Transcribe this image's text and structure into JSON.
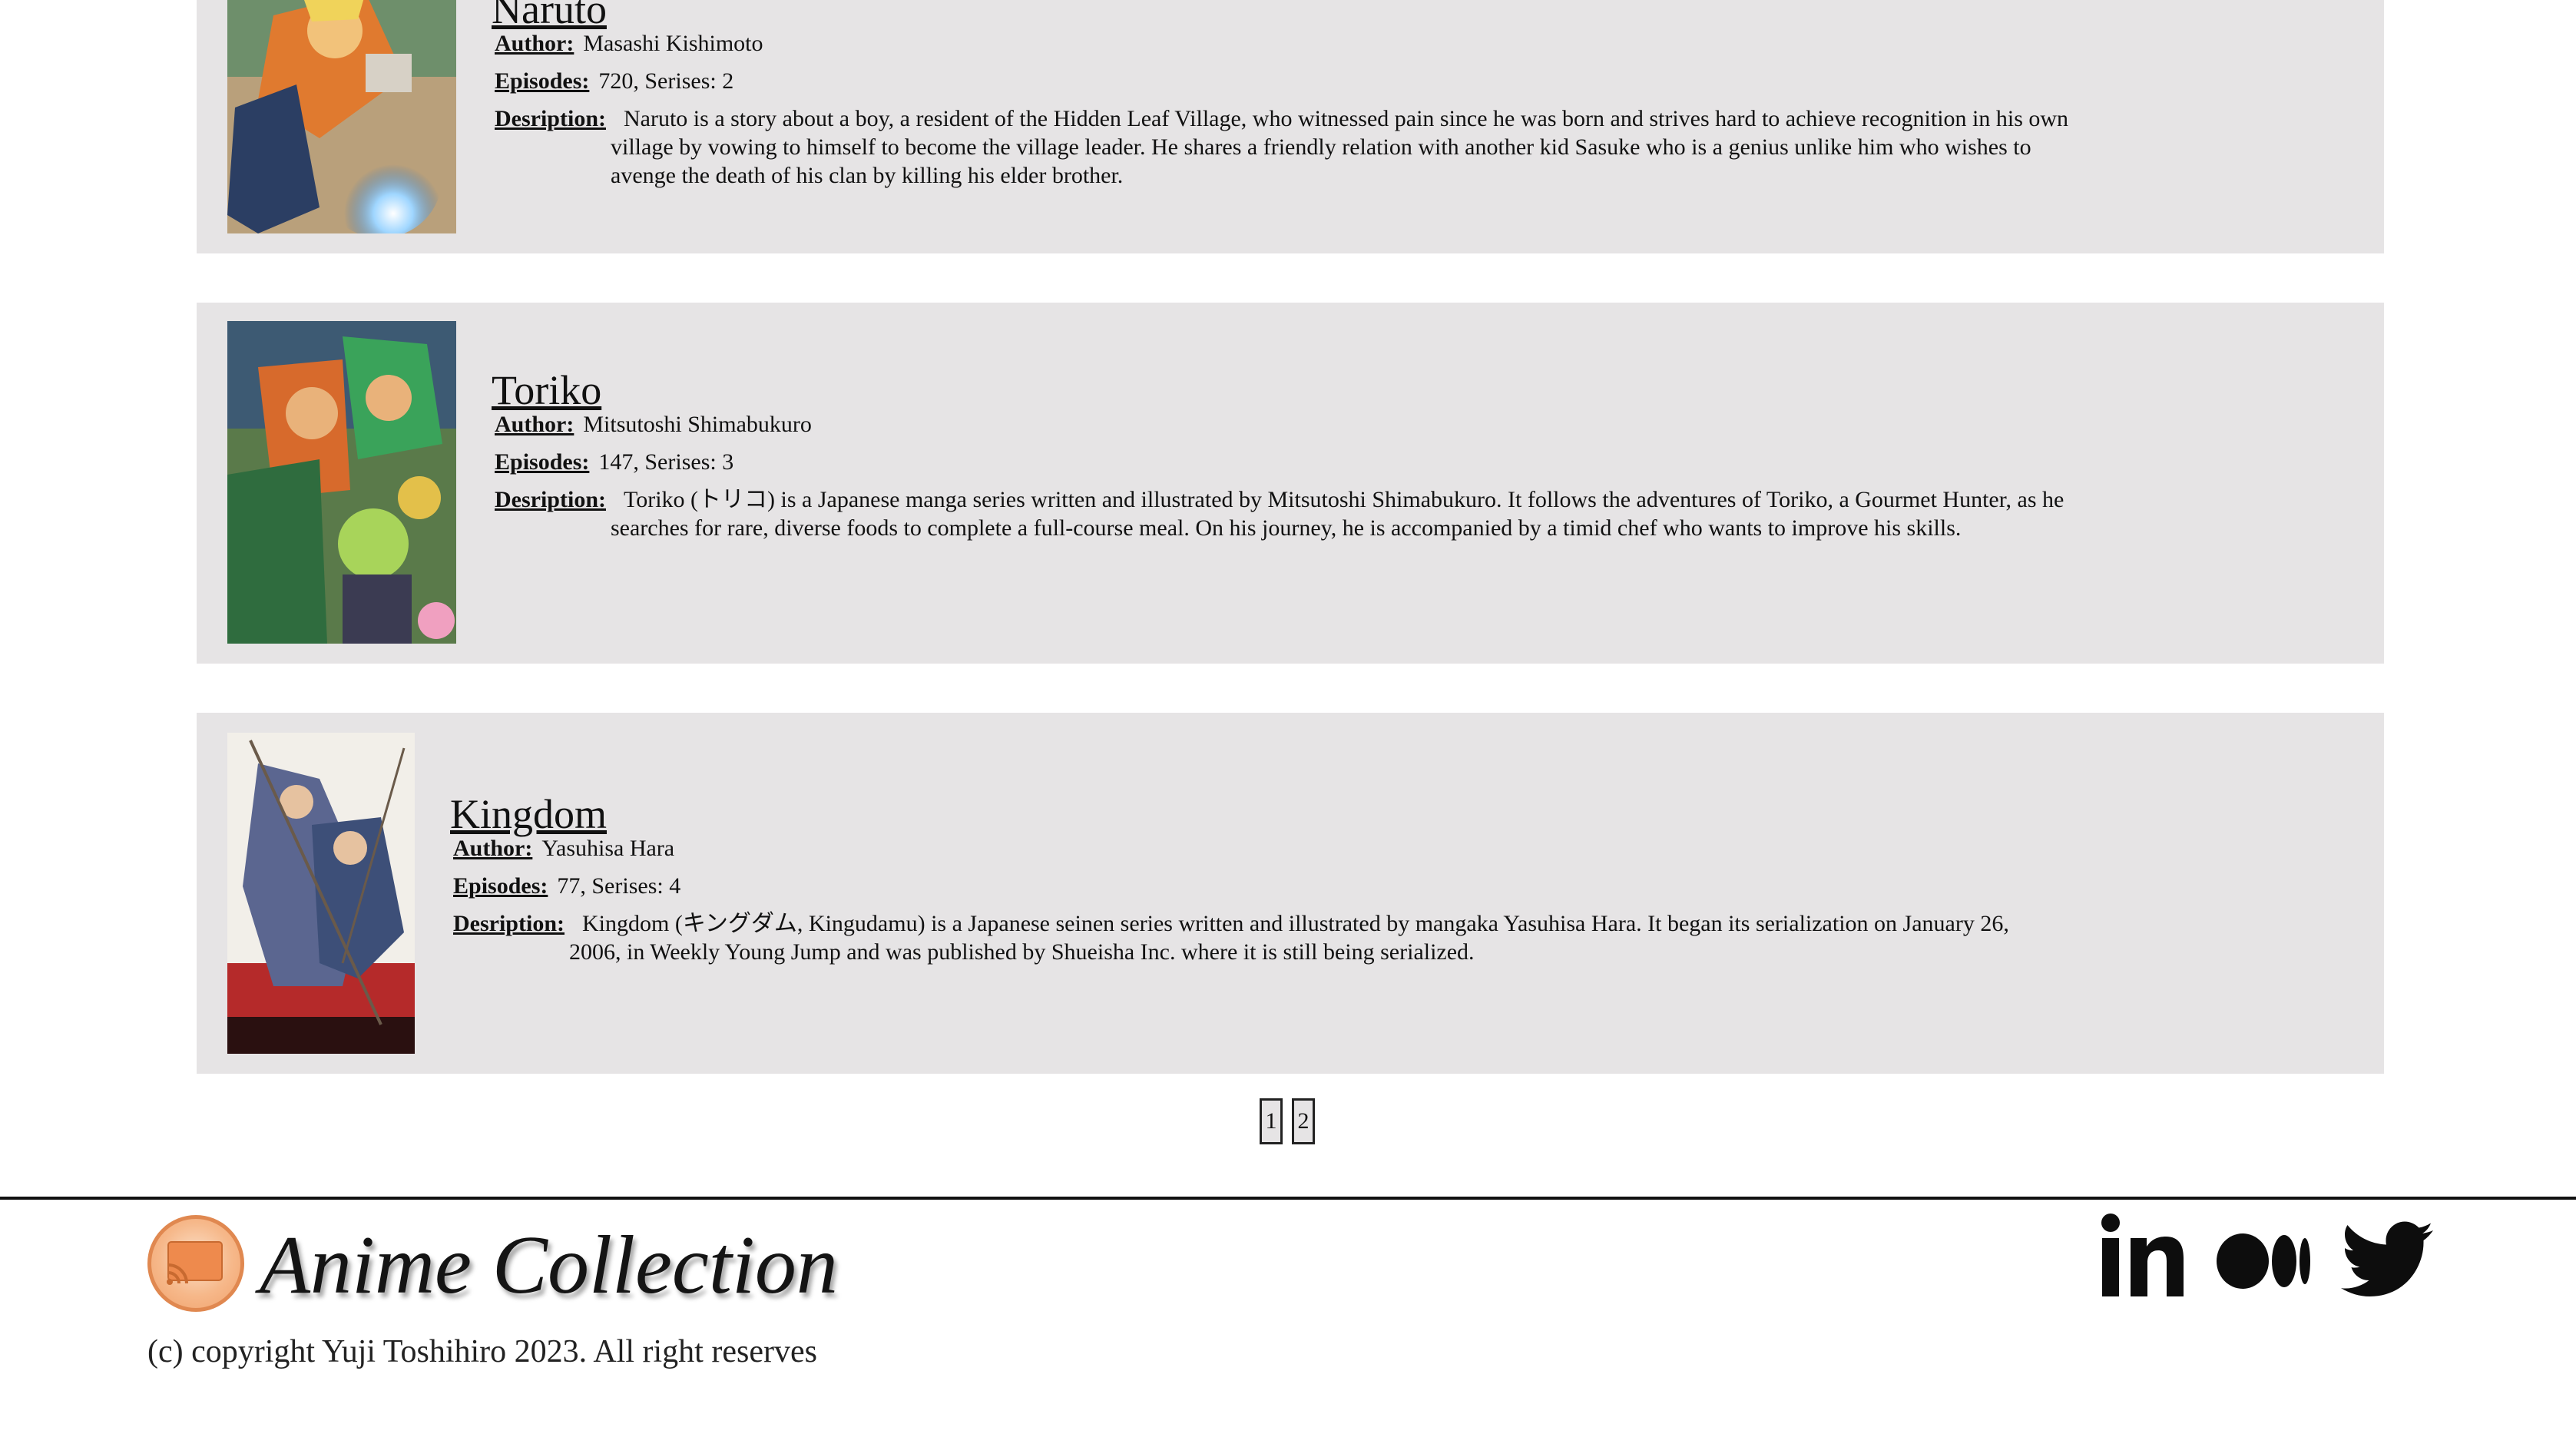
{
  "cards": [
    {
      "title": "Naruto",
      "author_label": "Author:",
      "author": "Masashi Kishimoto",
      "episodes_label": "Episodes:",
      "episodes": "720, Serises: 2",
      "desc_label": "Desription:",
      "description": "Naruto is a story about a boy, a resident of the Hidden Leaf Village, who witnessed pain since he was born and strives hard to achieve recognition in his own village by vowing to himself to become the village leader. He shares a friendly relation with another kid Sasuke who is a genius unlike him who wishes to avenge the death of his clan by killing his elder brother."
    },
    {
      "title": "Toriko",
      "author_label": "Author:",
      "author": "Mitsutoshi Shimabukuro",
      "episodes_label": "Episodes:",
      "episodes": "147, Serises: 3",
      "desc_label": "Desription:",
      "description": "Toriko (トリコ) is a Japanese manga series written and illustrated by Mitsutoshi Shimabukuro. It follows the adventures of Toriko, a Gourmet Hunter, as he searches for rare, diverse foods to complete a full-course meal. On his journey, he is accompanied by a timid chef who wants to improve his skills."
    },
    {
      "title": "Kingdom",
      "author_label": "Author:",
      "author": "Yasuhisa Hara",
      "episodes_label": "Episodes:",
      "episodes": "77, Serises: 4",
      "desc_label": "Desription:",
      "description": "Kingdom (キングダム, Kingudamu) is a Japanese seinen series written and illustrated by mangaka Yasuhisa Hara. It began its serialization on January 26, 2006, in Weekly Young Jump and was published by Shueisha Inc. where it is still being serialized."
    }
  ],
  "pagination": {
    "pages": [
      "1",
      "2"
    ]
  },
  "footer": {
    "brand": "Anime Collection",
    "copyright": "(c) copyright Yuji Toshihiro 2023. All right reserves",
    "social": [
      "linkedin-icon",
      "medium-icon",
      "twitter-icon"
    ]
  },
  "colors": {
    "card_bg": "#e6e4e5",
    "logo_accent": "#e08850"
  }
}
